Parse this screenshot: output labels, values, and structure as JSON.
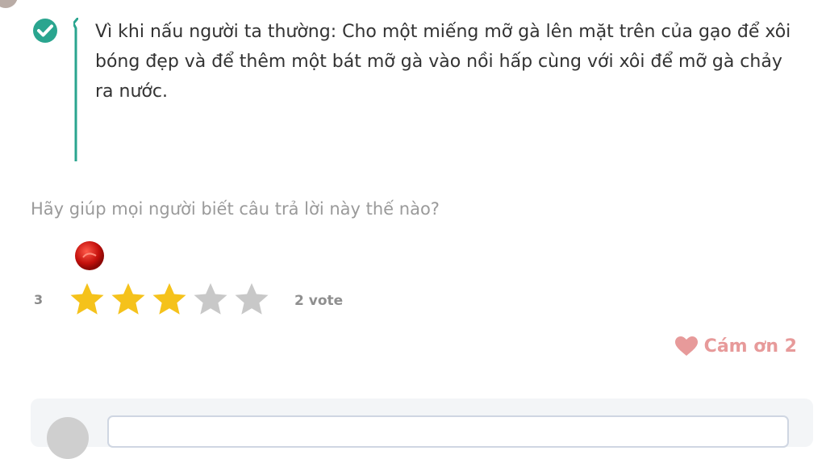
{
  "answer": {
    "text": "Vì khi nấu người ta thường: Cho một miếng mỡ gà lên mặt trên của gạo để xôi bóng đẹp và để thêm một bát mỡ gà vào nồi hấp cùng với xôi để mỡ gà chảy ra nước.",
    "accent_color": "#2aa58f"
  },
  "rating": {
    "prompt": "Hãy giúp mọi người biết câu trả lời này thế nào?",
    "average": "3",
    "stars_filled": 3,
    "stars_total": 5,
    "votes_label": "2 vote",
    "star_color_on": "#f5c21b",
    "star_color_off": "#c8c8c8"
  },
  "thanks": {
    "label": "Cám ơn 2",
    "color": "#e79a9a"
  },
  "comment": {
    "placeholder": ""
  },
  "icons": {
    "verified": "check-circle-icon",
    "badge": "red-badge-icon",
    "heart": "heart-icon"
  }
}
